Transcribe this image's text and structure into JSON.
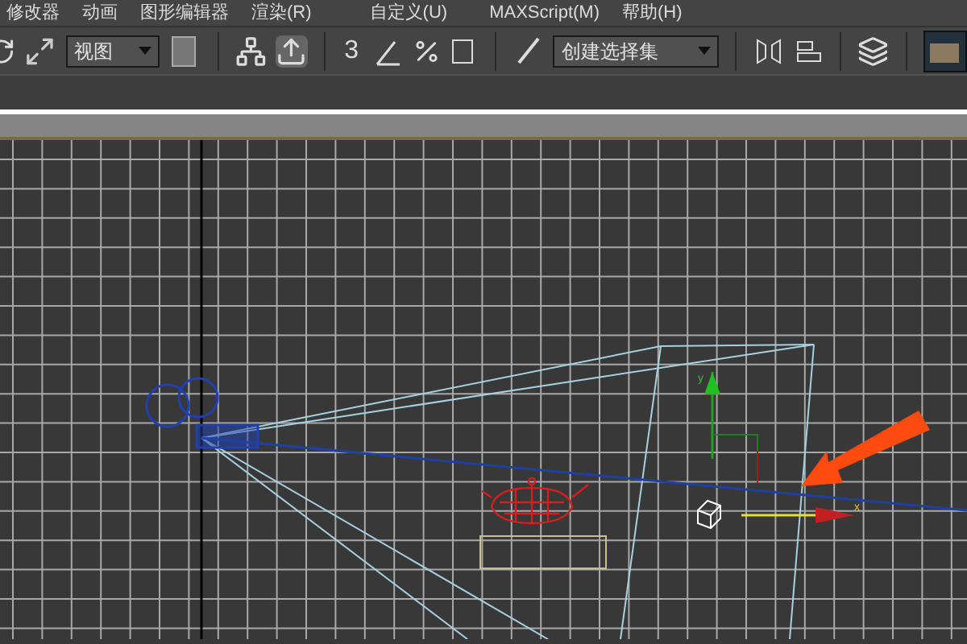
{
  "menu_bar": [
    "修改器",
    "动画",
    "图形编辑器",
    "渲染(R)",
    "自定义(U)",
    "MAXScript(M)",
    "帮助(H)"
  ],
  "toolbar": {
    "view_dropdown": {
      "value": "视图"
    },
    "snap_toggle": {
      "label": "3"
    },
    "selection_set_dropdown": {
      "value": "创建选择集"
    },
    "scene_explorer": {
      "selected": true
    }
  },
  "viewport": {
    "gizmo_labels": [
      "y",
      "x"
    ]
  }
}
